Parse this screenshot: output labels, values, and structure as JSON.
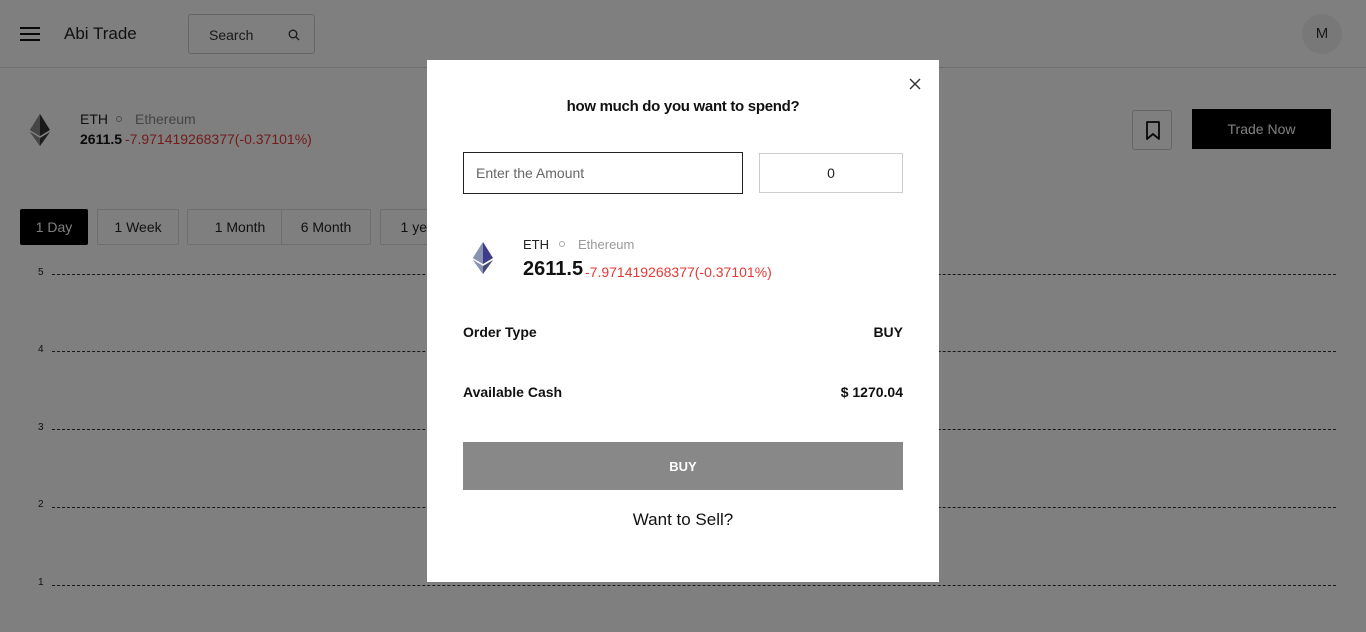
{
  "header": {
    "brand": "Abi Trade",
    "search_label": "Search",
    "avatar_initial": "M"
  },
  "asset": {
    "symbol": "ETH",
    "name": "Ethereum",
    "price": "2611.5",
    "change": "-7.971419268377(-0.37101%)",
    "trade_button": "Trade Now"
  },
  "range_tabs": [
    {
      "label": "1 Day",
      "active": true
    },
    {
      "label": "1 Week",
      "active": false
    },
    {
      "label": "1 Month",
      "active": false
    },
    {
      "label": "6 Month",
      "active": false
    },
    {
      "label": "1 year",
      "active": false
    }
  ],
  "chart": {
    "y_ticks": [
      "5",
      "4",
      "3",
      "2",
      "1"
    ]
  },
  "modal": {
    "title": "how much do you want to spend?",
    "amount_placeholder": "Enter the Amount",
    "quantity": "0",
    "symbol": "ETH",
    "name": "Ethereum",
    "price": "2611.5",
    "change": "-7.971419268377(-0.37101%)",
    "order_type_label": "Order Type",
    "order_type_value": "BUY",
    "cash_label": "Available Cash",
    "cash_value": "$ 1270.04",
    "buy_button": "BUY",
    "sell_link": "Want to Sell?"
  },
  "colors": {
    "negative": "#e53935",
    "overlay": "rgba(0,0,0,0.5)",
    "disabled_button": "#888888"
  }
}
